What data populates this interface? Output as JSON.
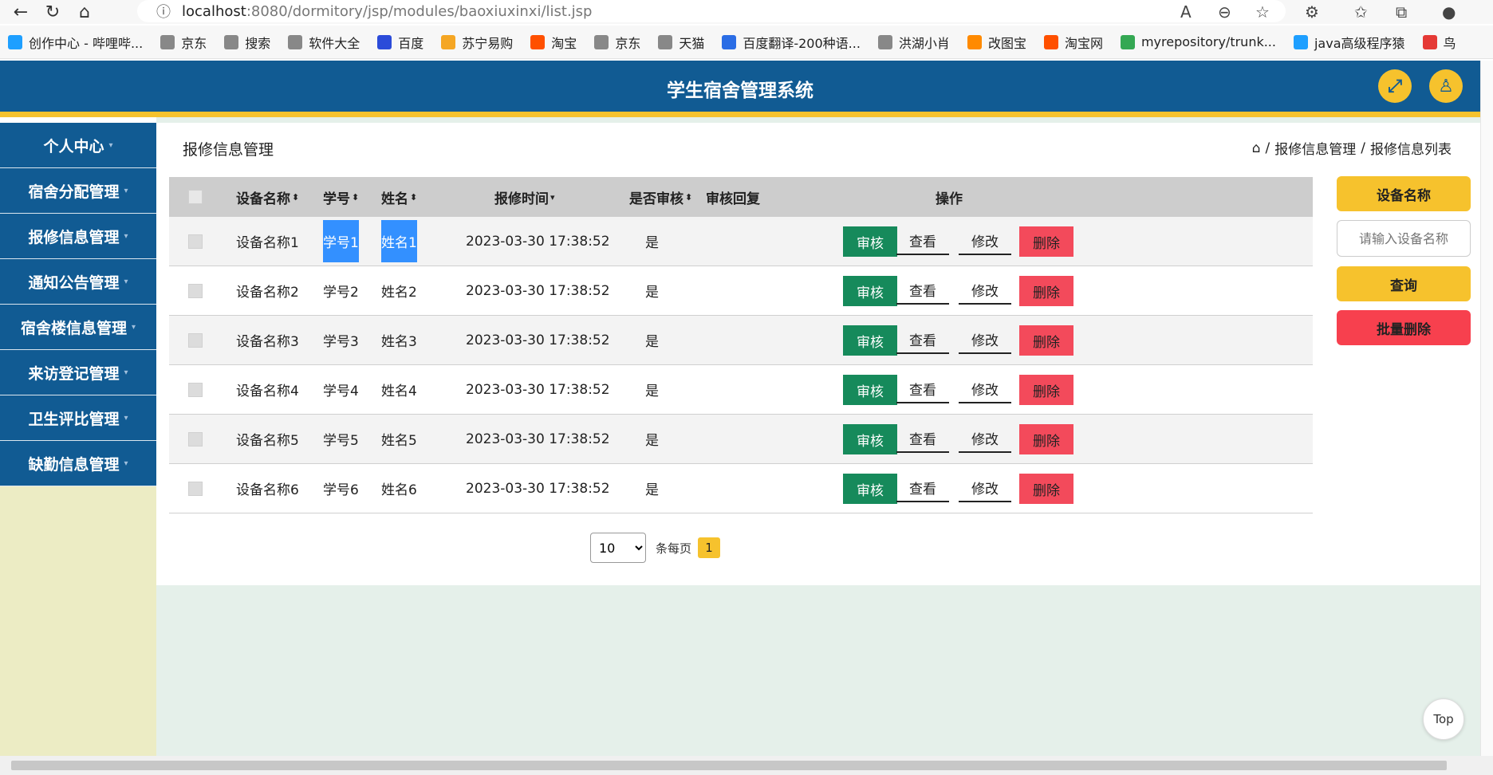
{
  "browser": {
    "url_host": "localhost",
    "url_rest": ":8080/dormitory/jsp/modules/baoxiuxinxi/list.jsp",
    "bookmarks": [
      {
        "label": "创作中心 - 哔哩哔...",
        "color": "#1e9fff"
      },
      {
        "label": "京东",
        "color": "#888888"
      },
      {
        "label": "搜索",
        "color": "#888888"
      },
      {
        "label": "软件大全",
        "color": "#888888"
      },
      {
        "label": "百度",
        "color": "#2b4bd9"
      },
      {
        "label": "苏宁易购",
        "color": "#f5a623"
      },
      {
        "label": "淘宝",
        "color": "#ff5000"
      },
      {
        "label": "京东",
        "color": "#888888"
      },
      {
        "label": "天猫",
        "color": "#888888"
      },
      {
        "label": "百度翻译-200种语...",
        "color": "#2b6de5"
      },
      {
        "label": "洪湖小肖",
        "color": "#888888"
      },
      {
        "label": "改图宝",
        "color": "#ff8a00"
      },
      {
        "label": "淘宝网",
        "color": "#ff5000"
      },
      {
        "label": "myrepository/trunk...",
        "color": "#34a853"
      },
      {
        "label": "java高级程序猿",
        "color": "#1e9fff"
      },
      {
        "label": "鸟",
        "color": "#e53935"
      }
    ]
  },
  "header": {
    "title": "学生宿舍管理系统",
    "fullscreen_icon": "expand-icon",
    "user_icon": "user-icon"
  },
  "sidebar": {
    "items": [
      {
        "label": "个人中心"
      },
      {
        "label": "宿舍分配管理"
      },
      {
        "label": "报修信息管理"
      },
      {
        "label": "通知公告管理"
      },
      {
        "label": "宿舍楼信息管理"
      },
      {
        "label": "来访登记管理"
      },
      {
        "label": "卫生评比管理"
      },
      {
        "label": "缺勤信息管理"
      }
    ]
  },
  "main": {
    "page_title": "报修信息管理",
    "breadcrumb": {
      "home_icon": "home-icon",
      "items": [
        "报修信息管理",
        "报修信息列表"
      ],
      "separator": "/"
    }
  },
  "table": {
    "columns": [
      "设备名称",
      "学号",
      "姓名",
      "报修时间",
      "是否审核",
      "审核回复",
      "操作"
    ],
    "rows": [
      {
        "device": "设备名称1",
        "student_no": "学号1",
        "name": "姓名1",
        "time": "2023-03-30 17:38:52",
        "audited": "是",
        "reply": ""
      },
      {
        "device": "设备名称2",
        "student_no": "学号2",
        "name": "姓名2",
        "time": "2023-03-30 17:38:52",
        "audited": "是",
        "reply": ""
      },
      {
        "device": "设备名称3",
        "student_no": "学号3",
        "name": "姓名3",
        "time": "2023-03-30 17:38:52",
        "audited": "是",
        "reply": ""
      },
      {
        "device": "设备名称4",
        "student_no": "学号4",
        "name": "姓名4",
        "time": "2023-03-30 17:38:52",
        "audited": "是",
        "reply": ""
      },
      {
        "device": "设备名称5",
        "student_no": "学号5",
        "name": "姓名5",
        "time": "2023-03-30 17:38:52",
        "audited": "是",
        "reply": ""
      },
      {
        "device": "设备名称6",
        "student_no": "学号6",
        "name": "姓名6",
        "time": "2023-03-30 17:38:52",
        "audited": "是",
        "reply": ""
      }
    ],
    "actions": {
      "audit": "审核",
      "view": "查看",
      "edit": "修改",
      "delete": "删除"
    }
  },
  "pagination": {
    "page_size": "10",
    "page_size_options": [
      "10"
    ],
    "per_page_label": "条每页",
    "current_page": "1"
  },
  "search": {
    "field_label": "设备名称",
    "placeholder": "请输入设备名称",
    "query_label": "查询",
    "batch_delete_label": "批量删除"
  },
  "back_to_top": "Top",
  "colors": {
    "primary": "#115b93",
    "accent": "#f6c22d",
    "audit": "#168a5b",
    "delete": "#f34a5b"
  }
}
